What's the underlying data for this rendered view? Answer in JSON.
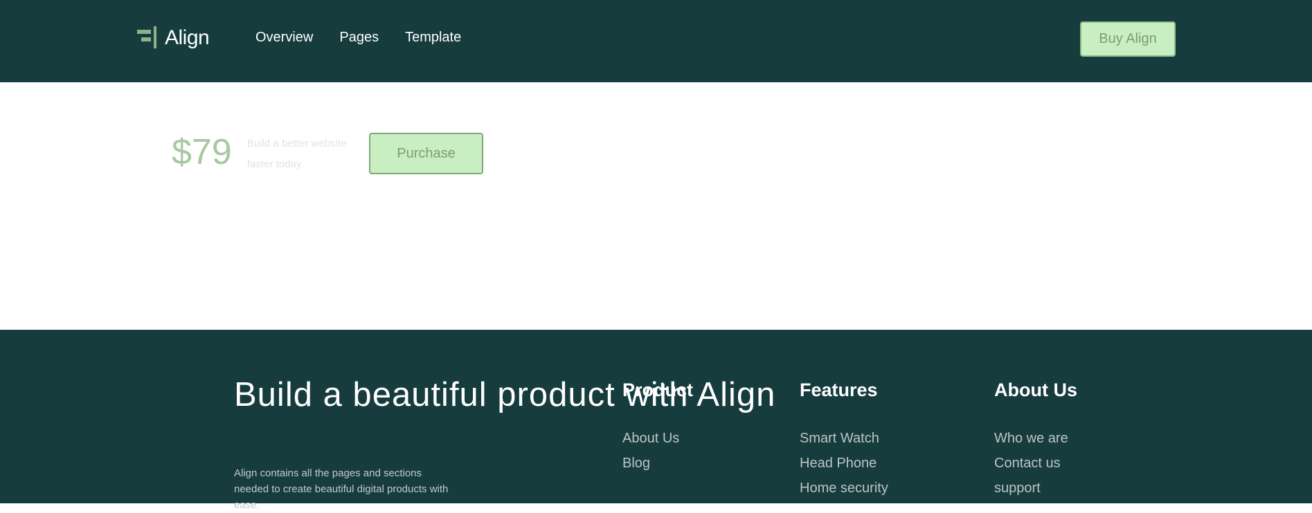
{
  "header": {
    "logo_text": "Align",
    "nav": [
      "Overview",
      "Pages",
      "Template"
    ],
    "buy_label": "Buy Align"
  },
  "hero": {
    "price": "$79",
    "tagline": "Build a better website faster today.",
    "purchase_label": "Purchase"
  },
  "footer": {
    "headline": "Build a beautiful product with Align",
    "description": "Align contains all the pages and sections needed to create beautiful digital products with ease.",
    "columns": [
      {
        "title": "Product",
        "links": [
          "About Us",
          "Blog"
        ]
      },
      {
        "title": "Features",
        "links": [
          "Smart Watch",
          "Head Phone",
          "Home security"
        ]
      },
      {
        "title": "About Us",
        "links": [
          "Who we are",
          "Contact us",
          "support"
        ]
      }
    ]
  },
  "colors": {
    "header_bg": "#163c3e",
    "accent": "#c8eec1",
    "accent_text": "#7d9b79"
  }
}
